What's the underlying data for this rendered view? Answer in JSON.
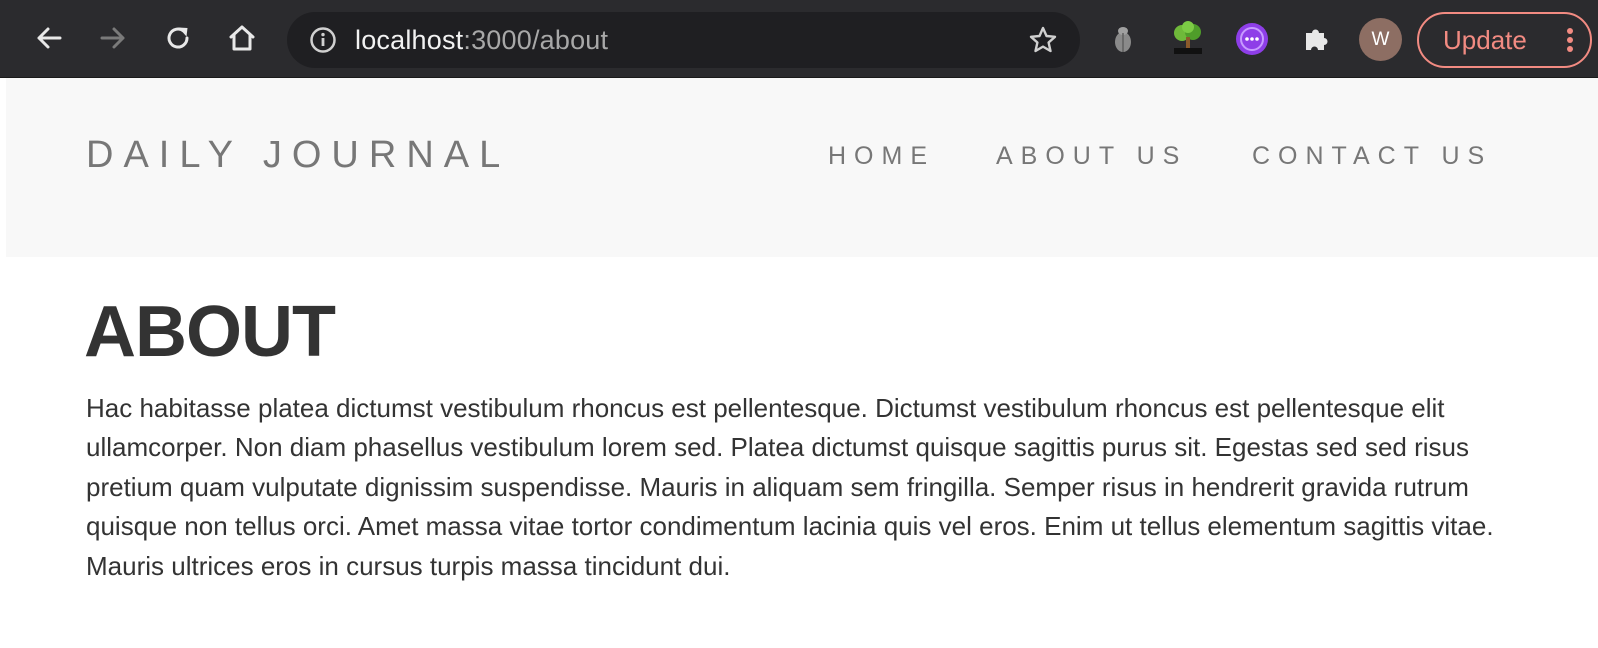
{
  "browser": {
    "url_host": "localhost",
    "url_rest": ":3000/about",
    "avatar_initial": "W",
    "update_label": "Update",
    "icons": {
      "back": "arrow-left-icon",
      "forward": "arrow-right-icon",
      "reload": "reload-icon",
      "home": "home-icon",
      "site_info": "info-icon",
      "bookmark": "star-icon",
      "extensions": [
        "bug-extension-icon",
        "tree-extension-icon",
        "purple-extension-icon",
        "puzzle-icon"
      ],
      "menu": "vertical-dots-icon"
    },
    "colors": {
      "toolbar": "#2b2b2e",
      "omnibox": "#1f1f22",
      "update_accent": "#f28b82",
      "avatar": "#8d6e63"
    }
  },
  "site": {
    "brand": "DAILY JOURNAL",
    "nav": {
      "home": "HOME",
      "about": "ABOUT US",
      "contact": "CONTACT US"
    },
    "colors": {
      "navbar_bg": "#f8f8f8",
      "nav_text": "#777777",
      "body_text": "#333333"
    }
  },
  "main": {
    "title": "ABOUT",
    "content": "Hac habitasse platea dictumst vestibulum rhoncus est pellentesque. Dictumst vestibulum rhoncus est pellentesque elit ullamcorper. Non diam phasellus vestibulum lorem sed. Platea dictumst quisque sagittis purus sit. Egestas sed sed risus pretium quam vulputate dignissim suspendisse. Mauris in aliquam sem fringilla. Semper risus in hendrerit gravida rutrum quisque non tellus orci. Amet massa vitae tortor condimentum lacinia quis vel eros. Enim ut tellus elementum sagittis vitae. Mauris ultrices eros in cursus turpis massa tincidunt dui."
  }
}
